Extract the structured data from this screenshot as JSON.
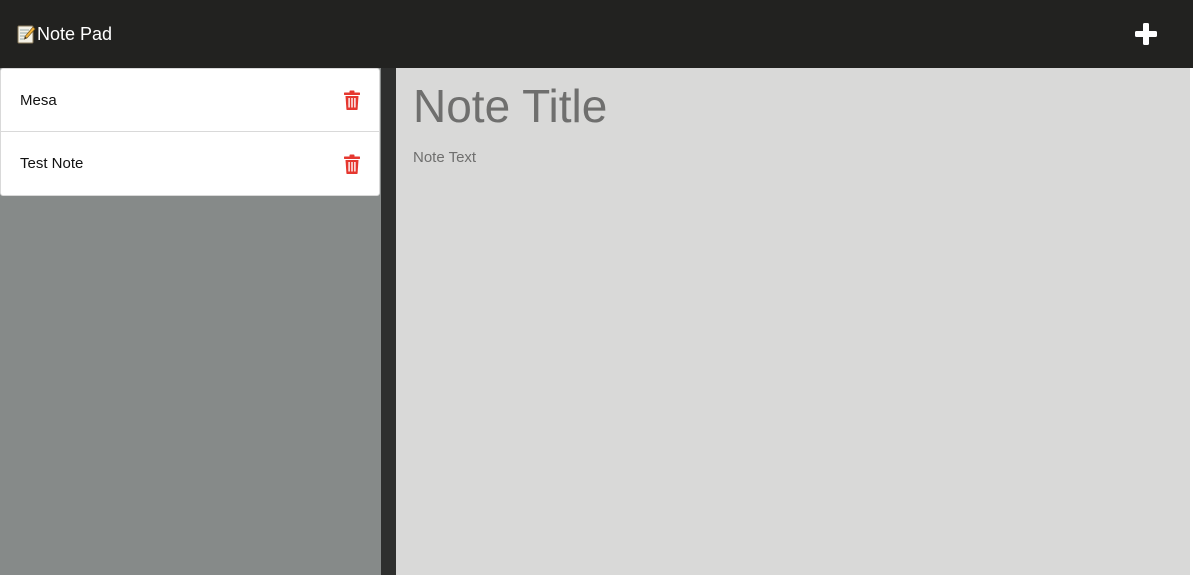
{
  "navbar": {
    "title": "Note Pad",
    "brand_icon": "memo-icon",
    "add_icon": "plus-icon"
  },
  "notes": [
    {
      "title": "Mesa",
      "delete_icon": "trash-icon"
    },
    {
      "title": "Test Note",
      "delete_icon": "trash-icon"
    }
  ],
  "editor": {
    "title_placeholder": "Note Title",
    "text_placeholder": "Note Text"
  },
  "colors": {
    "navbar_bg": "#222220",
    "sidebar_bg": "#868a89",
    "editor_bg": "#d9d9d8",
    "delete_red": "#e5372f"
  }
}
